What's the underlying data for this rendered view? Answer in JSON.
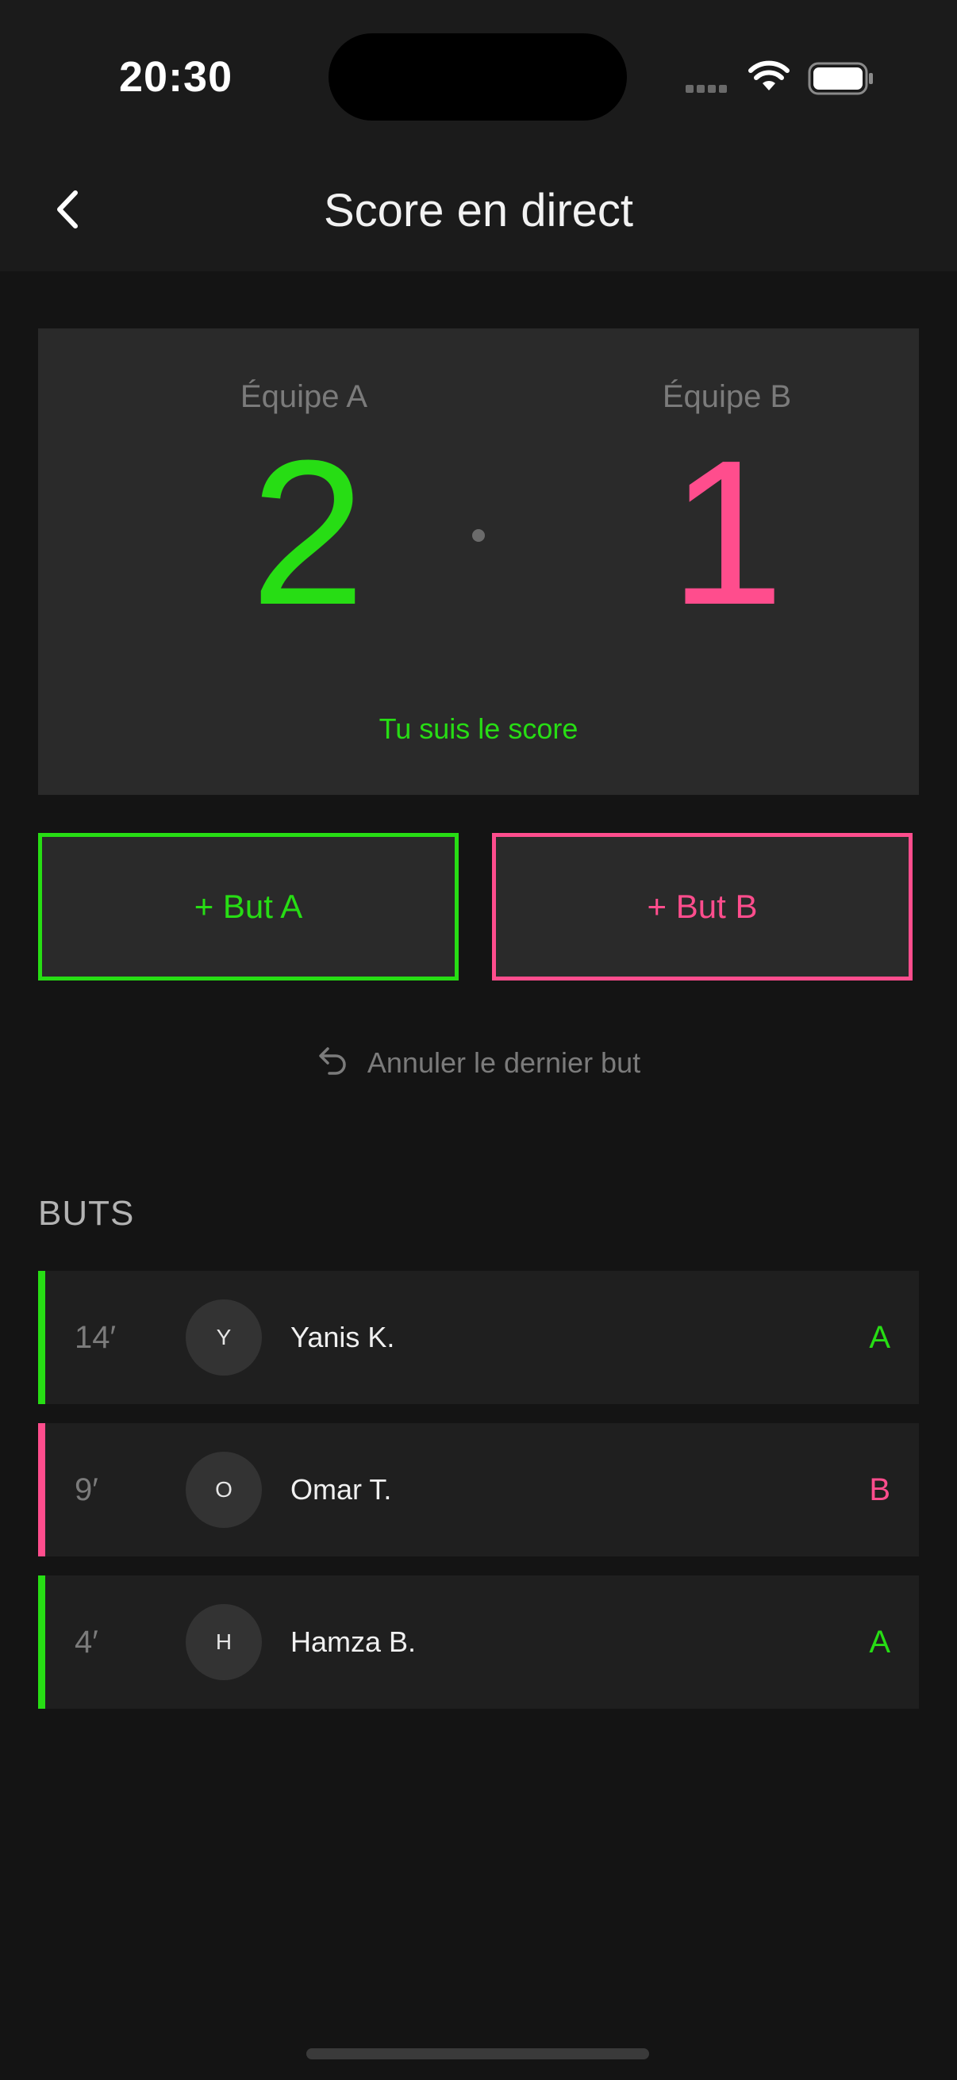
{
  "status_bar": {
    "time": "20:30"
  },
  "nav": {
    "title": "Score en direct"
  },
  "score": {
    "team_a_name": "Équipe A",
    "team_b_name": "Équipe B",
    "team_a_score": "2",
    "team_b_score": "1",
    "tracker_label": "Tu suis le score"
  },
  "actions": {
    "goal_a_label": "+ But A",
    "goal_b_label": "+ But B",
    "undo_label": "Annuler le dernier but"
  },
  "goals": {
    "section_title": "BUTS",
    "items": [
      {
        "minute": "14′",
        "initial": "Y",
        "player": "Yanis K.",
        "team": "A"
      },
      {
        "minute": "9′",
        "initial": "O",
        "player": "Omar T.",
        "team": "B"
      },
      {
        "minute": "4′",
        "initial": "H",
        "player": "Hamza B.",
        "team": "A"
      }
    ]
  },
  "colors": {
    "background": "#141414",
    "team_a": "#27dd14",
    "team_b": "#ff4d8d",
    "card": "#2a2a2a"
  }
}
